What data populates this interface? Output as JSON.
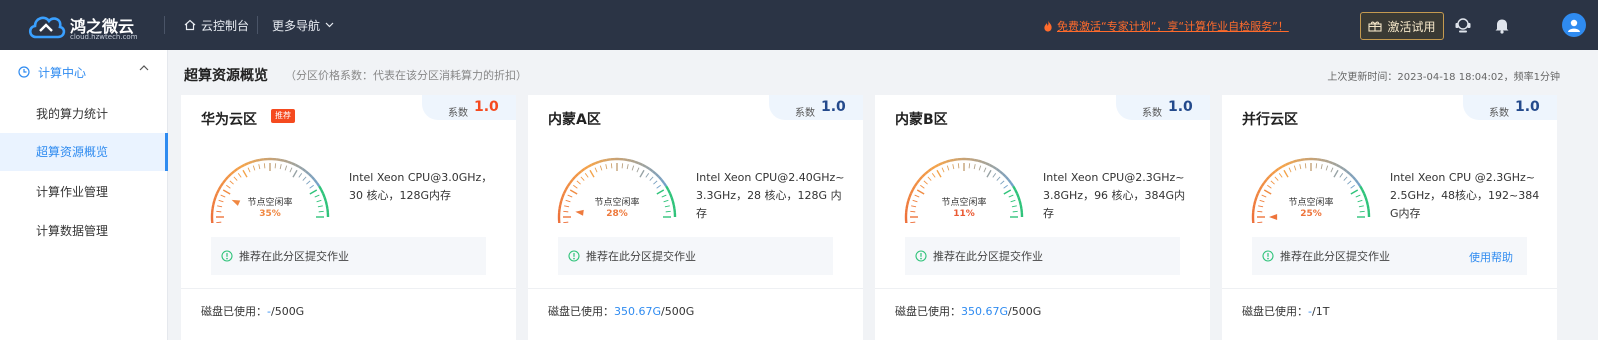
{
  "header": {
    "brand": "鸿之微云",
    "domain": "cloud.hzwtech.com",
    "nav_console": "云控制台",
    "nav_more": "更多导航",
    "promo": "免费激活“专家计划”，享“计算作业自检服务”！",
    "activate_label": "激活试用",
    "icons": [
      "headset-icon",
      "bell-icon",
      "user-avatar-icon"
    ]
  },
  "sidebar": {
    "group_label": "计算中心",
    "items": [
      {
        "label": "我的算力统计",
        "active": false
      },
      {
        "label": "超算资源概览",
        "active": true
      },
      {
        "label": "计算作业管理",
        "active": false
      },
      {
        "label": "计算数据管理",
        "active": false
      }
    ]
  },
  "main": {
    "title": "超算资源概览",
    "subtitle": "（分区价格系数：代表在该分区消耗算力的折扣）",
    "last_update": "上次更新时间：2023-04-18 18:04:02，频率1分钟"
  },
  "cards": [
    {
      "name": "华为云区",
      "badge": "推荐",
      "coef_label": "系数",
      "coef_value": "1.0",
      "coef_highlight": true,
      "gauge_label": "节点空闲率",
      "gauge_value_text": "35%",
      "gauge_value": 0.35,
      "cpu": "Intel Xeon CPU@3.0GHz，30 核心，128G内存",
      "tip": "推荐在此分区提交作业",
      "help": "",
      "disk_label": "磁盘已使用：",
      "disk_used": "-",
      "disk_total": "/500G"
    },
    {
      "name": "内蒙A区",
      "badge": "",
      "coef_label": "系数",
      "coef_value": "1.0",
      "coef_highlight": false,
      "gauge_label": "节点空闲率",
      "gauge_value_text": "28%",
      "gauge_value": 0.28,
      "cpu": "Intel Xeon CPU@2.40GHz~3.3GHz，28 核心，128G 内存",
      "tip": "推荐在此分区提交作业",
      "help": "",
      "disk_label": "磁盘已使用：",
      "disk_used": "350.67G",
      "disk_total": "/500G"
    },
    {
      "name": "内蒙B区",
      "badge": "",
      "coef_label": "系数",
      "coef_value": "1.0",
      "coef_highlight": false,
      "gauge_label": "节点空闲率",
      "gauge_value_text": "11%",
      "gauge_value": 0.11,
      "cpu": "Intel Xeon CPU@2.3GHz~3.8GHz，96 核心，384G内存",
      "tip": "推荐在此分区提交作业",
      "help": "",
      "disk_label": "磁盘已使用：",
      "disk_used": "350.67G",
      "disk_total": "/500G"
    },
    {
      "name": "并行云区",
      "badge": "",
      "coef_label": "系数",
      "coef_value": "1.0",
      "coef_highlight": false,
      "gauge_label": "节点空闲率",
      "gauge_value_text": "25%",
      "gauge_value": 0.25,
      "cpu": "Intel Xeon CPU @2.3GHz~2.5GHz，48核心，192~384G内存",
      "tip": "推荐在此分区提交作业",
      "help": "使用帮助",
      "disk_label": "磁盘已使用：",
      "disk_used": "-",
      "disk_total": "/1T"
    }
  ],
  "colors": {
    "topbar": "#2b3445",
    "accent": "#2f8bf0",
    "promo": "#ff6b2c",
    "badge": "#f54a1f",
    "gauge_low": "#e8452c",
    "gauge_mid": "#f3a34a",
    "gauge_high": "#2fc37a"
  }
}
